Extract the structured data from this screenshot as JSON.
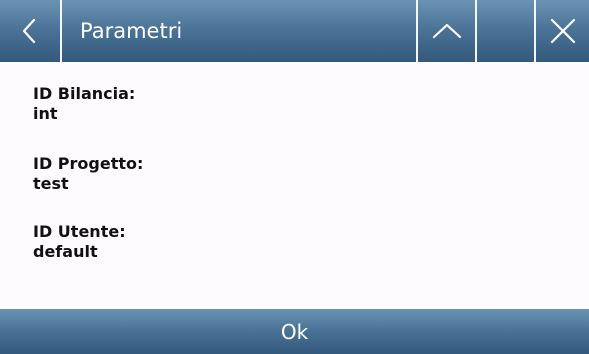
{
  "header": {
    "title": "Parametri",
    "back_icon": "chevron-left-icon",
    "up_icon": "chevron-up-icon",
    "close_icon": "close-icon"
  },
  "fields": [
    {
      "label": "ID Bilancia:",
      "value": "int"
    },
    {
      "label": "ID Progetto:",
      "value": "test"
    },
    {
      "label": "ID Utente:",
      "value": "default"
    }
  ],
  "footer": {
    "ok_label": "Ok"
  },
  "colors": {
    "bar_top": "#6a93b3",
    "bar_bottom": "#33597c",
    "background": "#fdfbfe",
    "separator": "#f4f7fa"
  }
}
